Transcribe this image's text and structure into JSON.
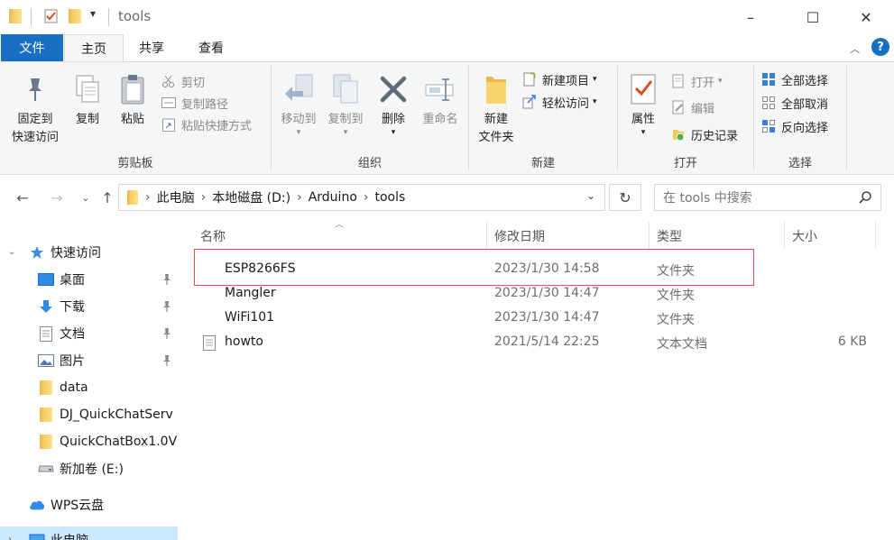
{
  "window": {
    "title": "tools",
    "minimize": "–",
    "maximize": "☐",
    "close": "✕"
  },
  "tabs": [
    {
      "label": "文件"
    },
    {
      "label": "主页"
    },
    {
      "label": "共享"
    },
    {
      "label": "查看"
    }
  ],
  "ribbon": {
    "clipboard": {
      "label": "剪贴板",
      "pin_line1": "固定到",
      "pin_line2": "快速访问",
      "copy": "复制",
      "paste": "粘贴",
      "cut": "剪切",
      "copy_path": "复制路径",
      "paste_shortcut": "粘贴快捷方式"
    },
    "organize": {
      "label": "组织",
      "move_to": "移动到",
      "copy_to": "复制到",
      "delete": "删除",
      "rename": "重命名"
    },
    "new": {
      "label": "新建",
      "new_folder_line1": "新建",
      "new_folder_line2": "文件夹",
      "new_item": "新建项目",
      "easy_access": "轻松访问"
    },
    "open": {
      "label": "打开",
      "properties": "属性",
      "open": "打开",
      "edit": "编辑",
      "history": "历史记录"
    },
    "select": {
      "label": "选择",
      "select_all": "全部选择",
      "select_none": "全部取消",
      "invert": "反向选择"
    }
  },
  "address": {
    "crumbs": [
      "此电脑",
      "本地磁盘 (D:)",
      "Arduino",
      "tools"
    ],
    "search_placeholder": "在 tools 中搜索"
  },
  "nav": {
    "quick_access": "快速访问",
    "items": [
      {
        "label": "桌面",
        "pinned": true
      },
      {
        "label": "下载",
        "pinned": true
      },
      {
        "label": "文档",
        "pinned": true
      },
      {
        "label": "图片",
        "pinned": true
      },
      {
        "label": "data",
        "pinned": false
      },
      {
        "label": "DJ_QuickChatServ",
        "pinned": false
      },
      {
        "label": "QuickChatBox1.0V",
        "pinned": false
      },
      {
        "label": "新加卷 (E:)",
        "pinned": false
      }
    ],
    "wps": "WPS云盘",
    "this_pc": "此电脑"
  },
  "columns": {
    "name": "名称",
    "date": "修改日期",
    "type": "类型",
    "size": "大小"
  },
  "files": [
    {
      "name": "ESP8266FS",
      "date": "2023/1/30 14:58",
      "type": "文件夹",
      "size": "",
      "kind": "folder"
    },
    {
      "name": "Mangler",
      "date": "2023/1/30 14:47",
      "type": "文件夹",
      "size": "",
      "kind": "folder"
    },
    {
      "name": "WiFi101",
      "date": "2023/1/30 14:47",
      "type": "文件夹",
      "size": "",
      "kind": "folder"
    },
    {
      "name": "howto",
      "date": "2021/5/14 22:25",
      "type": "文本文档",
      "size": "6 KB",
      "kind": "text"
    }
  ],
  "colors": {
    "file_tab": "#1970c2",
    "highlight_border": "#d9534f",
    "folder": "#f6d16a",
    "selected_bg": "#cce8ff"
  }
}
